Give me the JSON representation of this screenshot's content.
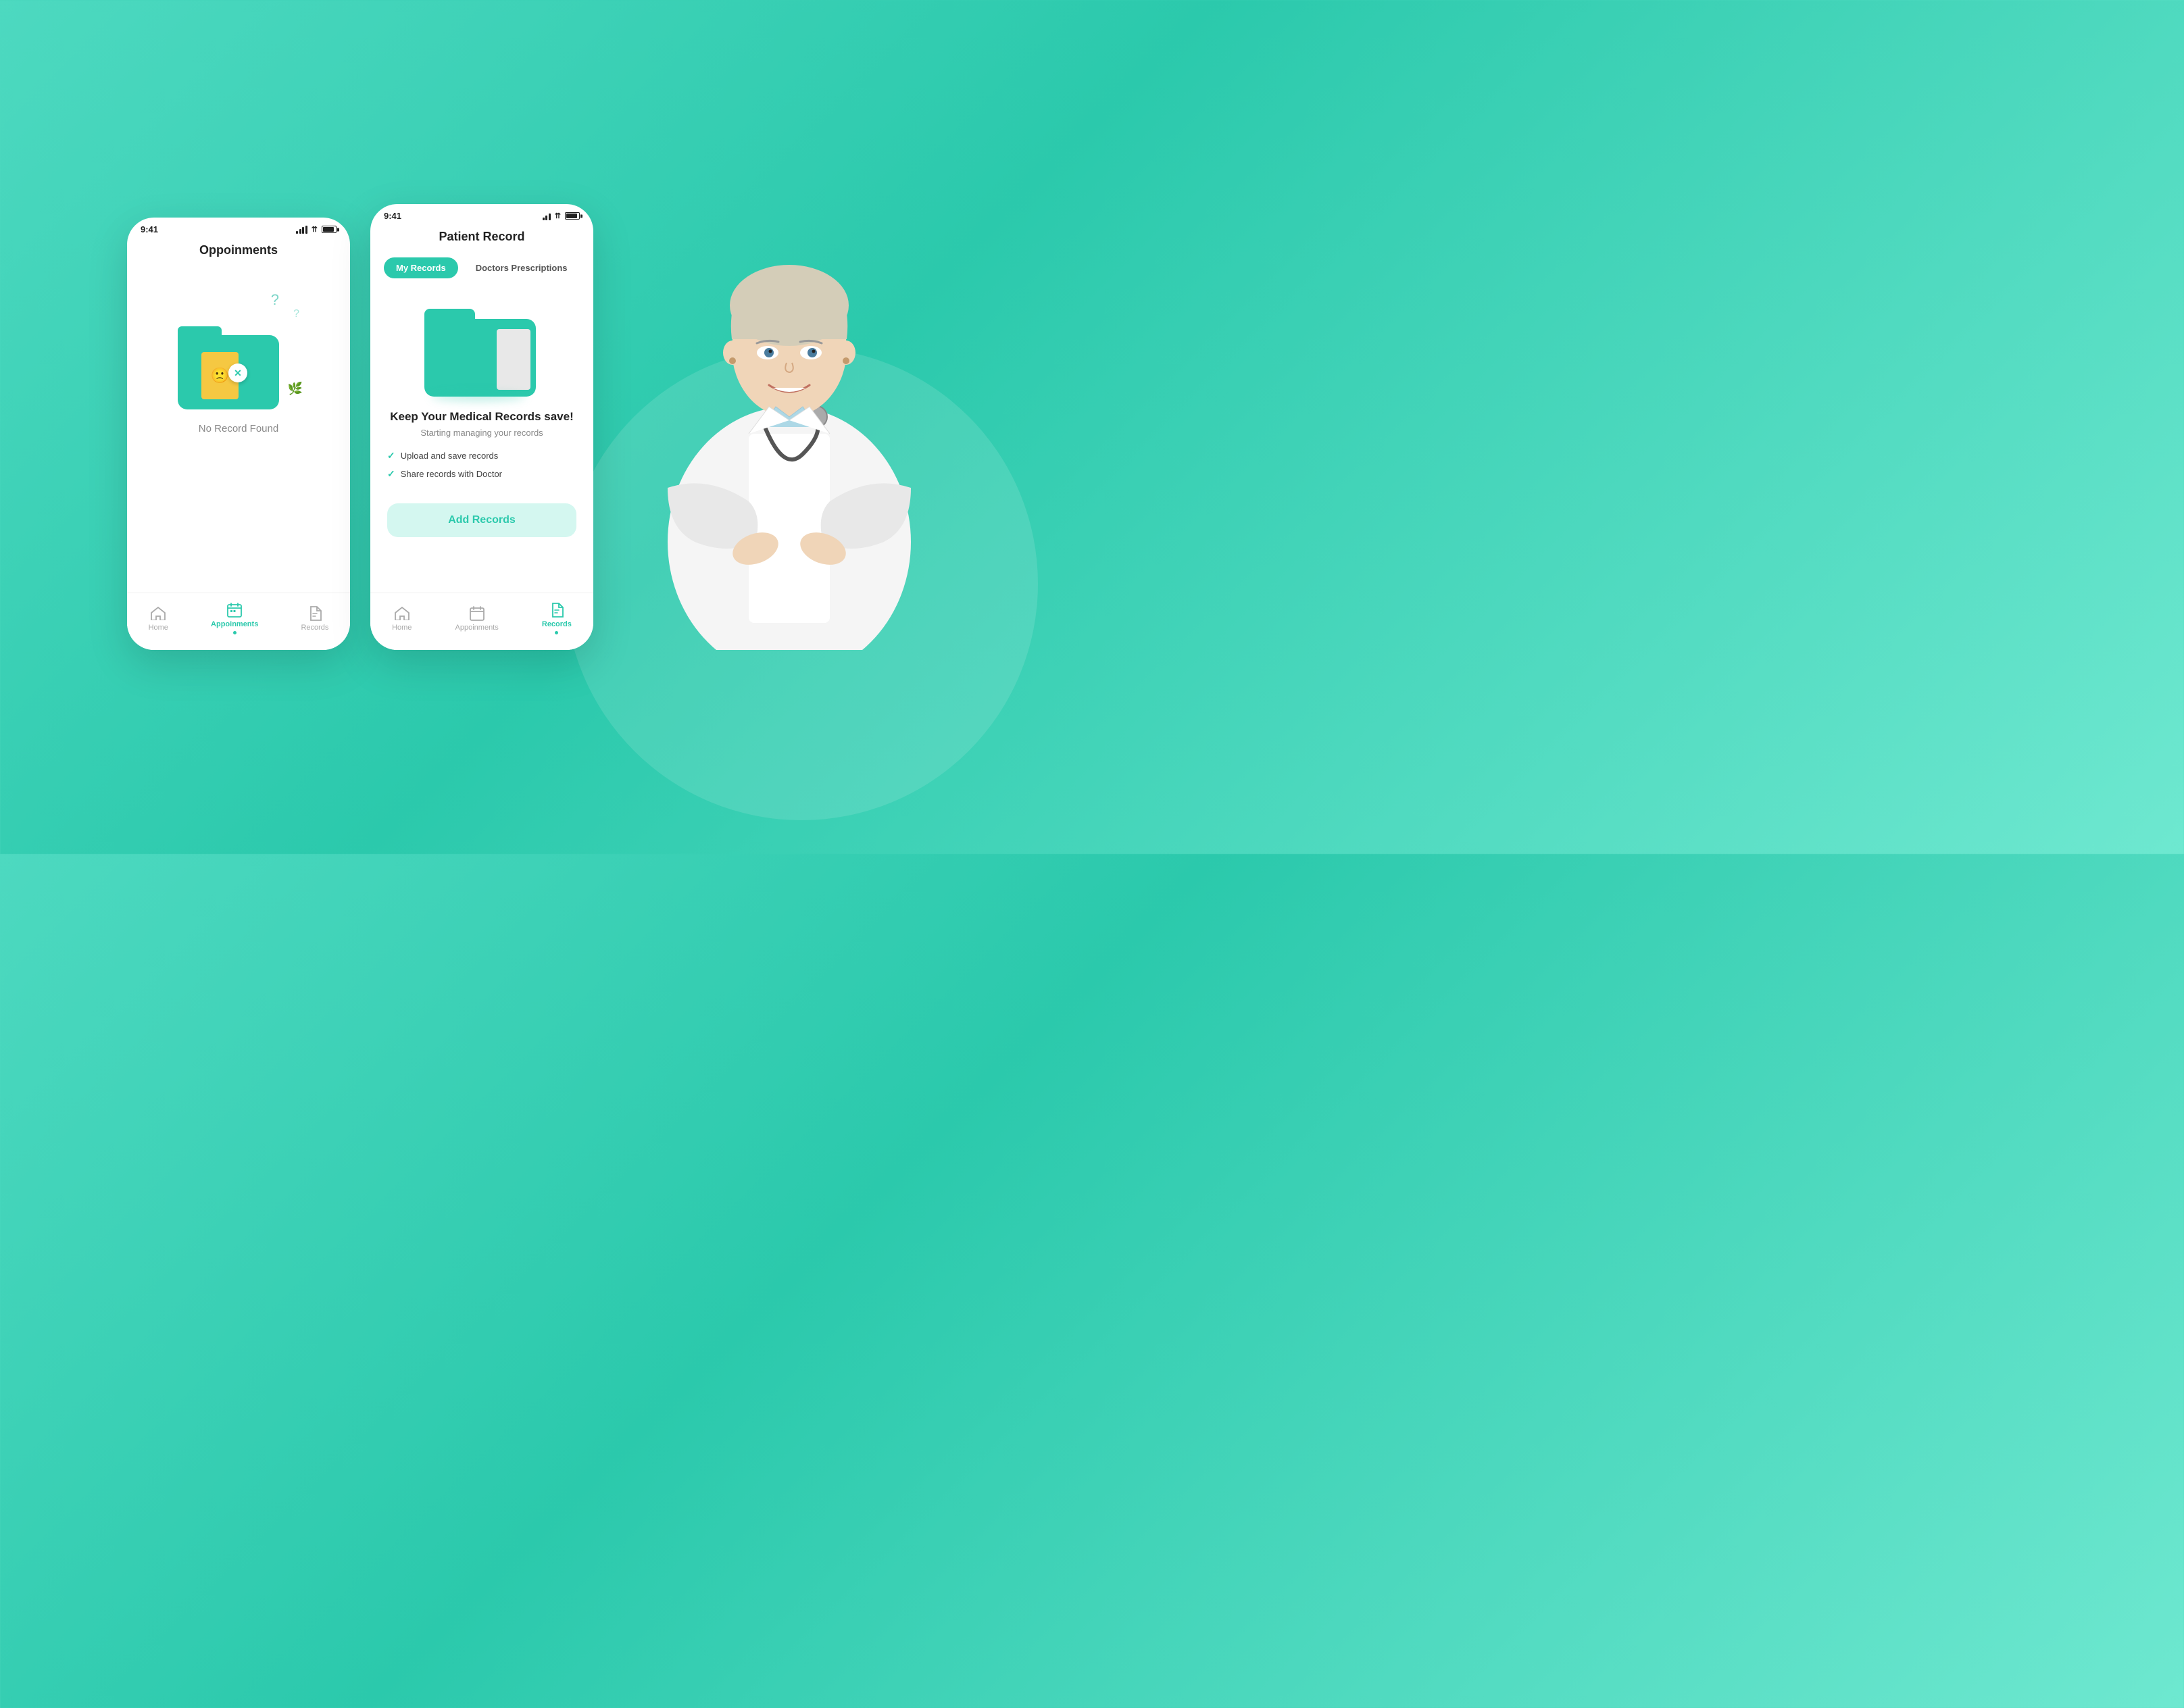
{
  "background": {
    "color": "#4dd9c0"
  },
  "phone_left": {
    "status": {
      "time": "9:41"
    },
    "title": "Oppoinments",
    "empty_label": "No Record Found",
    "nav": [
      {
        "id": "home",
        "label": "Home",
        "active": false
      },
      {
        "id": "appointments",
        "label": "Appoinments",
        "active": true
      },
      {
        "id": "records",
        "label": "Records",
        "active": false
      }
    ]
  },
  "phone_right": {
    "status": {
      "time": "9:41"
    },
    "title": "Patient Record",
    "tabs": [
      {
        "id": "my-records",
        "label": "My Records",
        "active": true
      },
      {
        "id": "doctors-prescriptions",
        "label": "Doctors Prescriptions",
        "active": false
      }
    ],
    "content": {
      "heading": "Keep Your Medical Records save!",
      "subtext": "Starting managing your records",
      "features": [
        "Upload and save records",
        "Share records with Doctor"
      ],
      "add_button": "Add Records"
    },
    "nav": [
      {
        "id": "home",
        "label": "Home",
        "active": false
      },
      {
        "id": "appointments",
        "label": "Appoinments",
        "active": false
      },
      {
        "id": "records",
        "label": "Records",
        "active": true
      }
    ]
  },
  "colors": {
    "teal": "#2bc9ac",
    "teal_light": "#d4f7f0",
    "yellow": "#f5c842",
    "text_dark": "#222222",
    "text_gray": "#888888"
  }
}
